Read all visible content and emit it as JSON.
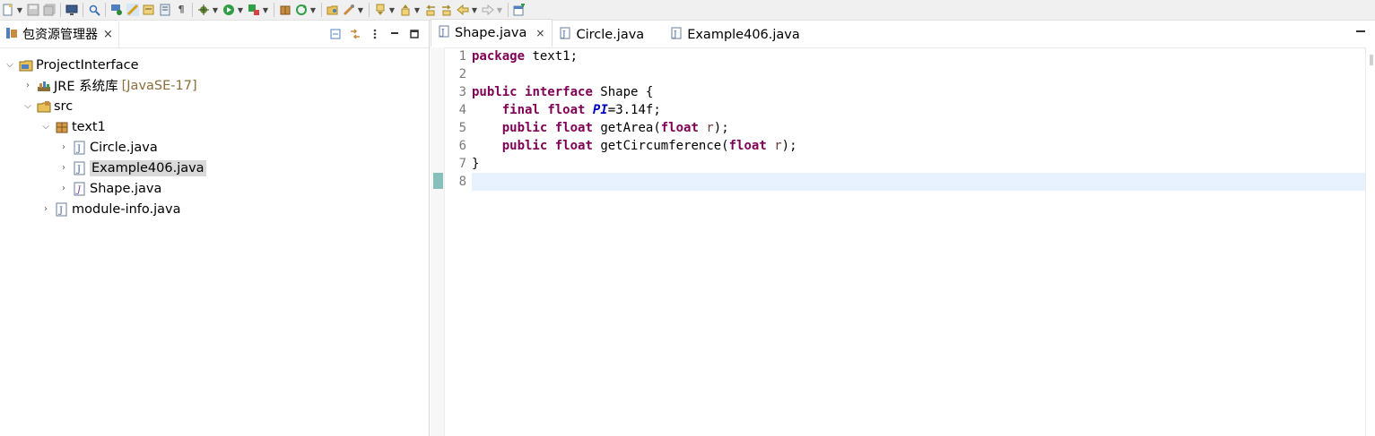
{
  "toolbar": {
    "icons": [
      "new-icon",
      "save-icon",
      "save-all-icon",
      "monitor-icon",
      "search-icon",
      "mark-icon",
      "highlight-icon",
      "toggle-icon",
      "block-icon",
      "paragraph-icon",
      "debug-icon",
      "run-icon",
      "run-external-icon",
      "package-icon",
      "refresh-icon",
      "open-icon",
      "tools-icon",
      "next-annotation-icon",
      "prev-annotation-icon",
      "last-edit-icon",
      "back-icon",
      "forward-icon",
      "new-window-icon"
    ]
  },
  "left_panel": {
    "tab_title": "包资源管理器",
    "tab_close": "×",
    "tree": [
      {
        "label": "ProjectInterface",
        "decor": "",
        "depth": 0,
        "expanded": true,
        "icon": "project-icon"
      },
      {
        "label": "JRE 系统库",
        "decor": "[JavaSE-17]",
        "depth": 1,
        "expanded": false,
        "icon": "library-icon"
      },
      {
        "label": "src",
        "decor": "",
        "depth": 1,
        "expanded": true,
        "icon": "source-folder-icon"
      },
      {
        "label": "text1",
        "decor": "",
        "depth": 2,
        "expanded": true,
        "icon": "package-icon"
      },
      {
        "label": "Circle.java",
        "decor": "",
        "depth": 3,
        "expanded": false,
        "icon": "java-file-icon"
      },
      {
        "label": "Example406.java",
        "decor": "",
        "depth": 3,
        "expanded": false,
        "icon": "java-file-icon",
        "selected": true
      },
      {
        "label": "Shape.java",
        "decor": "",
        "depth": 3,
        "expanded": false,
        "icon": "java-interface-file-icon"
      },
      {
        "label": "module-info.java",
        "decor": "",
        "depth": 2,
        "expanded": false,
        "icon": "java-file-icon"
      }
    ]
  },
  "editor": {
    "tabs": [
      {
        "label": "Shape.java",
        "active": true,
        "close": "×"
      },
      {
        "label": "Circle.java",
        "active": false
      },
      {
        "label": "Example406.java",
        "active": false
      }
    ],
    "line_numbers": [
      "1",
      "2",
      "3",
      "4",
      "5",
      "6",
      "7",
      "8"
    ],
    "code": [
      "package text1;",
      "",
      "public interface Shape {",
      "    final float PI=3.14f;",
      "    public float getArea(float r);",
      "    public float getCircumference(float r);",
      "}",
      ""
    ],
    "current_line": 8
  },
  "colors": {
    "keyword": "#7f0055",
    "constant": "#0000c0",
    "current_line_bg": "#e8f2fe",
    "selection_bg": "#d9d9d9"
  }
}
